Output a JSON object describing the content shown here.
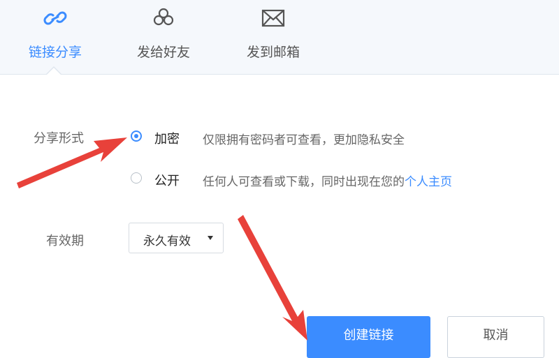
{
  "tabs": [
    {
      "label": "链接分享",
      "icon": "link-icon",
      "active": true
    },
    {
      "label": "发给好友",
      "icon": "friends-icon",
      "active": false
    },
    {
      "label": "发到邮箱",
      "icon": "mail-icon",
      "active": false
    }
  ],
  "share_form": {
    "label": "分享形式",
    "options": [
      {
        "title": "加密",
        "desc": "仅限拥有密码者可查看，更加隐私安全",
        "selected": true
      },
      {
        "title": "公开",
        "desc_prefix": "任何人可查看或下载，同时出现在您的",
        "desc_link": "个人主页",
        "selected": false
      }
    ]
  },
  "validity": {
    "label": "有效期",
    "selected": "永久有效"
  },
  "buttons": {
    "create": "创建链接",
    "cancel": "取消"
  },
  "colors": {
    "accent": "#3b8cff",
    "annotation_arrow": "#e8413a"
  }
}
